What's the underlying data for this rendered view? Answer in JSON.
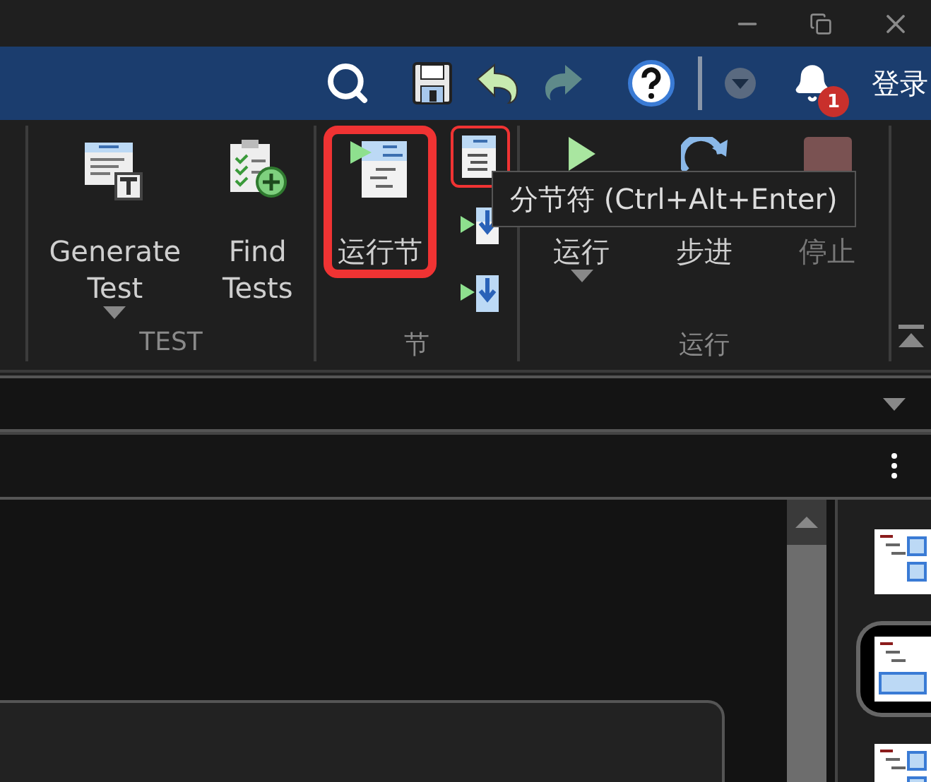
{
  "header": {
    "notification_count": "1",
    "account_label": "登录"
  },
  "ribbon": {
    "groups": [
      {
        "label": "TEST",
        "buttons": [
          {
            "kind": "large",
            "label": "Generate\nTest",
            "dropdown": true,
            "disabled": false,
            "highlighted": false
          },
          {
            "kind": "large",
            "label": "Find\nTests",
            "dropdown": false,
            "disabled": false,
            "highlighted": false
          }
        ]
      },
      {
        "label": "节",
        "buttons": [
          {
            "kind": "large",
            "label": "运行节",
            "dropdown": false,
            "disabled": false,
            "highlighted": true
          },
          {
            "kind": "small",
            "dropdown": false,
            "disabled": false,
            "highlighted": true
          },
          {
            "kind": "small",
            "dropdown": false,
            "disabled": false,
            "highlighted": false
          },
          {
            "kind": "small",
            "dropdown": false,
            "disabled": false,
            "highlighted": false
          }
        ]
      },
      {
        "label": "运行",
        "buttons": [
          {
            "kind": "large",
            "label": "运行",
            "dropdown": true,
            "disabled": false,
            "highlighted": false
          },
          {
            "kind": "large",
            "label": "步进",
            "dropdown": false,
            "disabled": false,
            "highlighted": false
          },
          {
            "kind": "large",
            "label": "停止",
            "dropdown": false,
            "disabled": true,
            "highlighted": false
          }
        ]
      }
    ]
  },
  "tooltip": {
    "text": "分节符 (Ctrl+Alt+Enter)"
  },
  "side_tools": [
    {
      "selected": false
    },
    {
      "selected": true
    },
    {
      "selected": false
    }
  ]
}
